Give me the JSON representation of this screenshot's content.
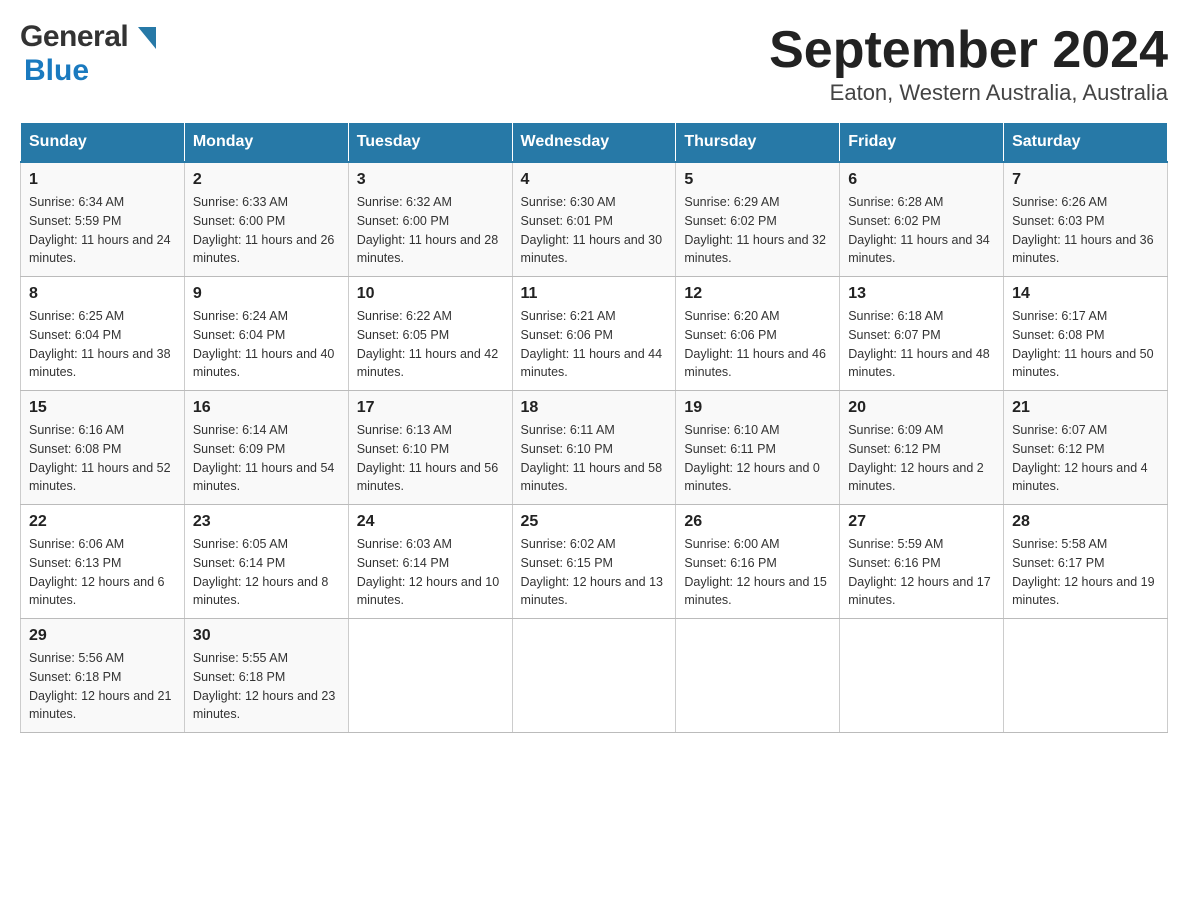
{
  "logo": {
    "general": "General",
    "blue": "Blue"
  },
  "title": "September 2024",
  "subtitle": "Eaton, Western Australia, Australia",
  "days_of_week": [
    "Sunday",
    "Monday",
    "Tuesday",
    "Wednesday",
    "Thursday",
    "Friday",
    "Saturday"
  ],
  "weeks": [
    [
      {
        "day": "1",
        "sunrise": "Sunrise: 6:34 AM",
        "sunset": "Sunset: 5:59 PM",
        "daylight": "Daylight: 11 hours and 24 minutes."
      },
      {
        "day": "2",
        "sunrise": "Sunrise: 6:33 AM",
        "sunset": "Sunset: 6:00 PM",
        "daylight": "Daylight: 11 hours and 26 minutes."
      },
      {
        "day": "3",
        "sunrise": "Sunrise: 6:32 AM",
        "sunset": "Sunset: 6:00 PM",
        "daylight": "Daylight: 11 hours and 28 minutes."
      },
      {
        "day": "4",
        "sunrise": "Sunrise: 6:30 AM",
        "sunset": "Sunset: 6:01 PM",
        "daylight": "Daylight: 11 hours and 30 minutes."
      },
      {
        "day": "5",
        "sunrise": "Sunrise: 6:29 AM",
        "sunset": "Sunset: 6:02 PM",
        "daylight": "Daylight: 11 hours and 32 minutes."
      },
      {
        "day": "6",
        "sunrise": "Sunrise: 6:28 AM",
        "sunset": "Sunset: 6:02 PM",
        "daylight": "Daylight: 11 hours and 34 minutes."
      },
      {
        "day": "7",
        "sunrise": "Sunrise: 6:26 AM",
        "sunset": "Sunset: 6:03 PM",
        "daylight": "Daylight: 11 hours and 36 minutes."
      }
    ],
    [
      {
        "day": "8",
        "sunrise": "Sunrise: 6:25 AM",
        "sunset": "Sunset: 6:04 PM",
        "daylight": "Daylight: 11 hours and 38 minutes."
      },
      {
        "day": "9",
        "sunrise": "Sunrise: 6:24 AM",
        "sunset": "Sunset: 6:04 PM",
        "daylight": "Daylight: 11 hours and 40 minutes."
      },
      {
        "day": "10",
        "sunrise": "Sunrise: 6:22 AM",
        "sunset": "Sunset: 6:05 PM",
        "daylight": "Daylight: 11 hours and 42 minutes."
      },
      {
        "day": "11",
        "sunrise": "Sunrise: 6:21 AM",
        "sunset": "Sunset: 6:06 PM",
        "daylight": "Daylight: 11 hours and 44 minutes."
      },
      {
        "day": "12",
        "sunrise": "Sunrise: 6:20 AM",
        "sunset": "Sunset: 6:06 PM",
        "daylight": "Daylight: 11 hours and 46 minutes."
      },
      {
        "day": "13",
        "sunrise": "Sunrise: 6:18 AM",
        "sunset": "Sunset: 6:07 PM",
        "daylight": "Daylight: 11 hours and 48 minutes."
      },
      {
        "day": "14",
        "sunrise": "Sunrise: 6:17 AM",
        "sunset": "Sunset: 6:08 PM",
        "daylight": "Daylight: 11 hours and 50 minutes."
      }
    ],
    [
      {
        "day": "15",
        "sunrise": "Sunrise: 6:16 AM",
        "sunset": "Sunset: 6:08 PM",
        "daylight": "Daylight: 11 hours and 52 minutes."
      },
      {
        "day": "16",
        "sunrise": "Sunrise: 6:14 AM",
        "sunset": "Sunset: 6:09 PM",
        "daylight": "Daylight: 11 hours and 54 minutes."
      },
      {
        "day": "17",
        "sunrise": "Sunrise: 6:13 AM",
        "sunset": "Sunset: 6:10 PM",
        "daylight": "Daylight: 11 hours and 56 minutes."
      },
      {
        "day": "18",
        "sunrise": "Sunrise: 6:11 AM",
        "sunset": "Sunset: 6:10 PM",
        "daylight": "Daylight: 11 hours and 58 minutes."
      },
      {
        "day": "19",
        "sunrise": "Sunrise: 6:10 AM",
        "sunset": "Sunset: 6:11 PM",
        "daylight": "Daylight: 12 hours and 0 minutes."
      },
      {
        "day": "20",
        "sunrise": "Sunrise: 6:09 AM",
        "sunset": "Sunset: 6:12 PM",
        "daylight": "Daylight: 12 hours and 2 minutes."
      },
      {
        "day": "21",
        "sunrise": "Sunrise: 6:07 AM",
        "sunset": "Sunset: 6:12 PM",
        "daylight": "Daylight: 12 hours and 4 minutes."
      }
    ],
    [
      {
        "day": "22",
        "sunrise": "Sunrise: 6:06 AM",
        "sunset": "Sunset: 6:13 PM",
        "daylight": "Daylight: 12 hours and 6 minutes."
      },
      {
        "day": "23",
        "sunrise": "Sunrise: 6:05 AM",
        "sunset": "Sunset: 6:14 PM",
        "daylight": "Daylight: 12 hours and 8 minutes."
      },
      {
        "day": "24",
        "sunrise": "Sunrise: 6:03 AM",
        "sunset": "Sunset: 6:14 PM",
        "daylight": "Daylight: 12 hours and 10 minutes."
      },
      {
        "day": "25",
        "sunrise": "Sunrise: 6:02 AM",
        "sunset": "Sunset: 6:15 PM",
        "daylight": "Daylight: 12 hours and 13 minutes."
      },
      {
        "day": "26",
        "sunrise": "Sunrise: 6:00 AM",
        "sunset": "Sunset: 6:16 PM",
        "daylight": "Daylight: 12 hours and 15 minutes."
      },
      {
        "day": "27",
        "sunrise": "Sunrise: 5:59 AM",
        "sunset": "Sunset: 6:16 PM",
        "daylight": "Daylight: 12 hours and 17 minutes."
      },
      {
        "day": "28",
        "sunrise": "Sunrise: 5:58 AM",
        "sunset": "Sunset: 6:17 PM",
        "daylight": "Daylight: 12 hours and 19 minutes."
      }
    ],
    [
      {
        "day": "29",
        "sunrise": "Sunrise: 5:56 AM",
        "sunset": "Sunset: 6:18 PM",
        "daylight": "Daylight: 12 hours and 21 minutes."
      },
      {
        "day": "30",
        "sunrise": "Sunrise: 5:55 AM",
        "sunset": "Sunset: 6:18 PM",
        "daylight": "Daylight: 12 hours and 23 minutes."
      },
      null,
      null,
      null,
      null,
      null
    ]
  ]
}
